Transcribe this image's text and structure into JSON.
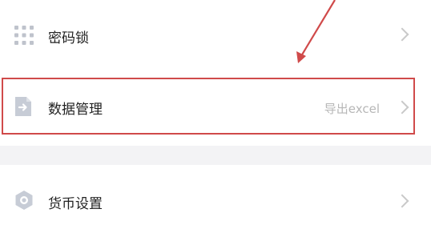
{
  "settings": {
    "items": [
      {
        "label": "密码锁",
        "icon": "keypad-grid-icon"
      },
      {
        "label": "数据管理",
        "value": "导出excel",
        "icon": "file-export-icon"
      },
      {
        "label": "货币设置",
        "icon": "currency-hexagon-icon"
      }
    ]
  },
  "annotation": {
    "highlight_color": "#d04a4a"
  }
}
